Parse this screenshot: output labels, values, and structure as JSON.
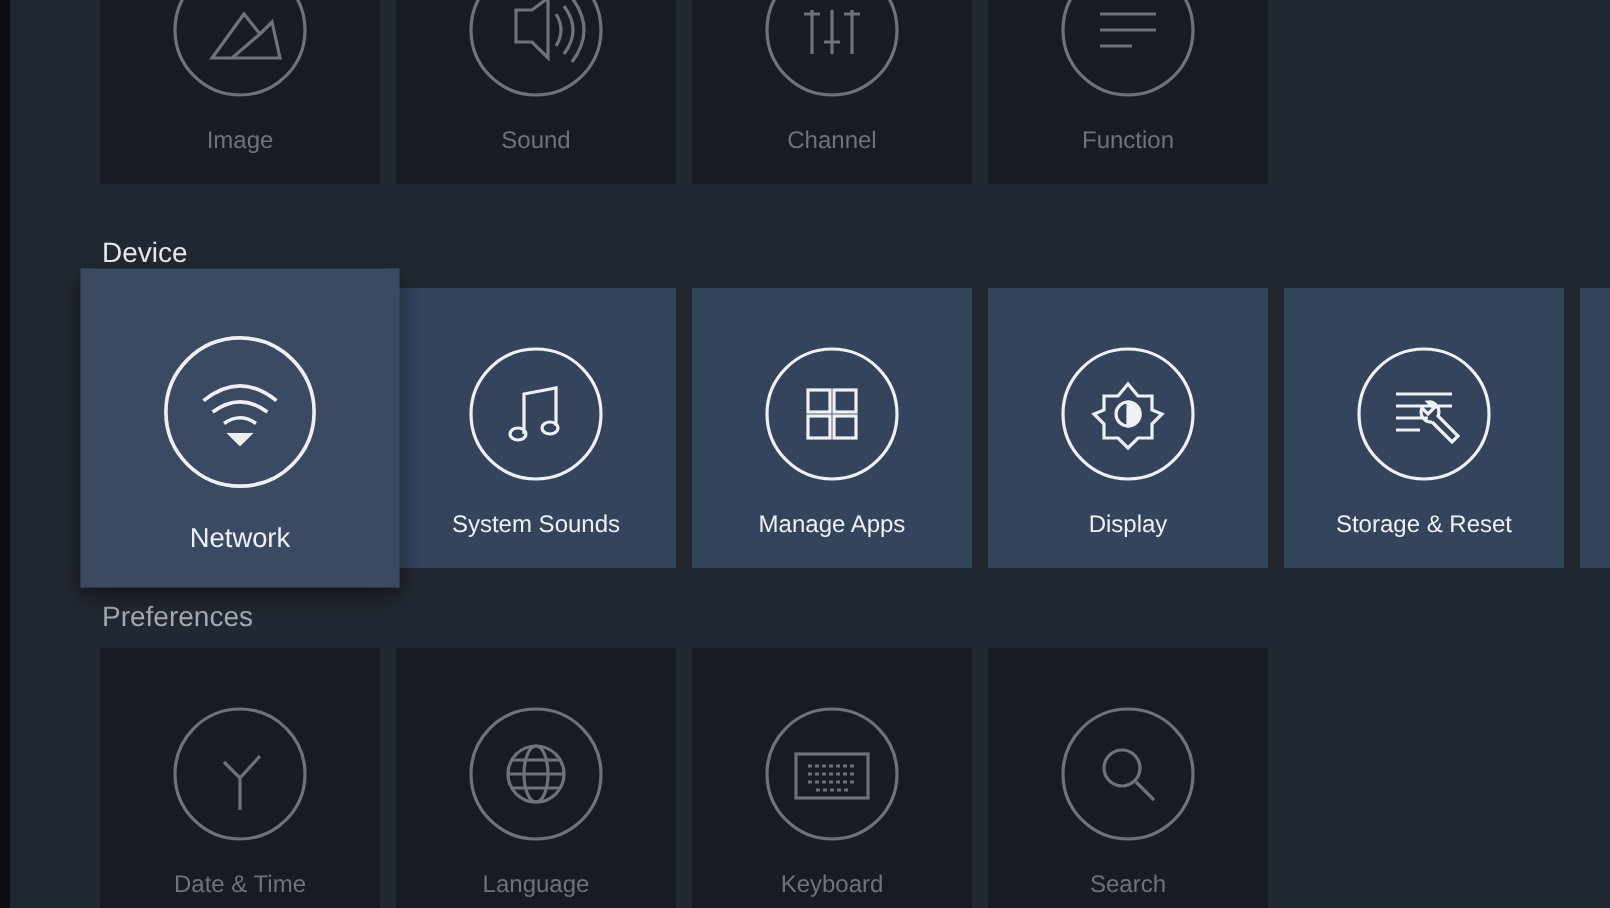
{
  "sections": [
    {
      "active": false,
      "tiles": [
        {
          "label": "Image",
          "selected": false
        },
        {
          "label": "Sound",
          "selected": false
        },
        {
          "label": "Channel",
          "selected": false
        },
        {
          "label": "Function",
          "selected": false
        }
      ]
    },
    {
      "title": "Device",
      "active": true,
      "tiles": [
        {
          "label": "Network",
          "selected": true
        },
        {
          "label": "System Sounds",
          "selected": false
        },
        {
          "label": "Manage Apps",
          "selected": false
        },
        {
          "label": "Display",
          "selected": false
        },
        {
          "label": "Storage & Reset",
          "selected": false
        },
        {
          "selected": false
        }
      ]
    },
    {
      "title": "Preferences",
      "active": false,
      "tiles": [
        {
          "label": "Date & Time",
          "selected": false
        },
        {
          "label": "Language",
          "selected": false
        },
        {
          "label": "Keyboard",
          "selected": false
        },
        {
          "label": "Search",
          "selected": false
        }
      ]
    }
  ]
}
